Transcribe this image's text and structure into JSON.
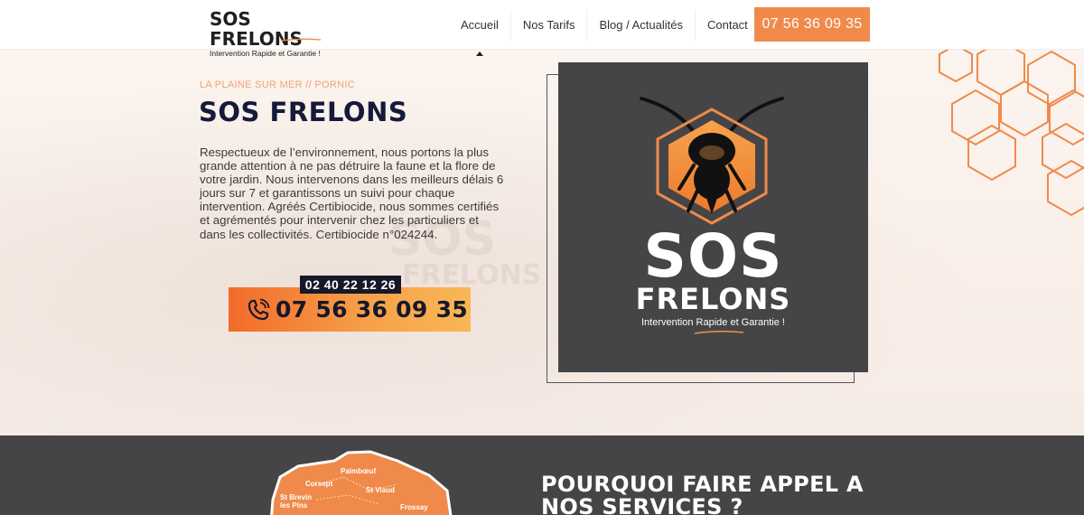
{
  "brand": {
    "name": "SOS FRELONS",
    "tagline": "Intervention Rapide et Garantie !"
  },
  "nav": {
    "items": [
      "Accueil",
      "Nos Tarifs",
      "Blog / Actualités",
      "Contact"
    ],
    "active": "Accueil"
  },
  "header_phone": "07 56 36 09 35",
  "hero": {
    "kicker": "LA PLAINE SUR MER // PORNIC",
    "title": "SOS FRELONS",
    "description": "Respectueux de l’environnement, nous portons la plus grande attention à ne pas détruire la faune et la flore de votre jardin. Nous intervenons dans les meilleurs délais 6 jours sur 7 et garantissons un suivi pour chaque intervention. Agréés Certibiocide, nous sommes certifiés et agrémentés pour intervenir chez les particuliers et dans les collectivités. Certibiocide n°024244.",
    "phone_secondary": "02 40 22 12 26",
    "phone_primary": "07 56 36 09 35"
  },
  "logo_box": {
    "line1": "SOS",
    "line2": "FRELONS",
    "tagline": "Intervention Rapide et Garantie !"
  },
  "section2": {
    "title": "POURQUOI FAIRE APPEL A NOS SERVICES ?",
    "map_labels": [
      "Paimbœuf",
      "Corsept",
      "St Viaud",
      "St Brevin les Pins",
      "Frossay"
    ]
  },
  "colors": {
    "accent": "#f08a4b",
    "dark": "#454547",
    "navy": "#151a3a"
  }
}
